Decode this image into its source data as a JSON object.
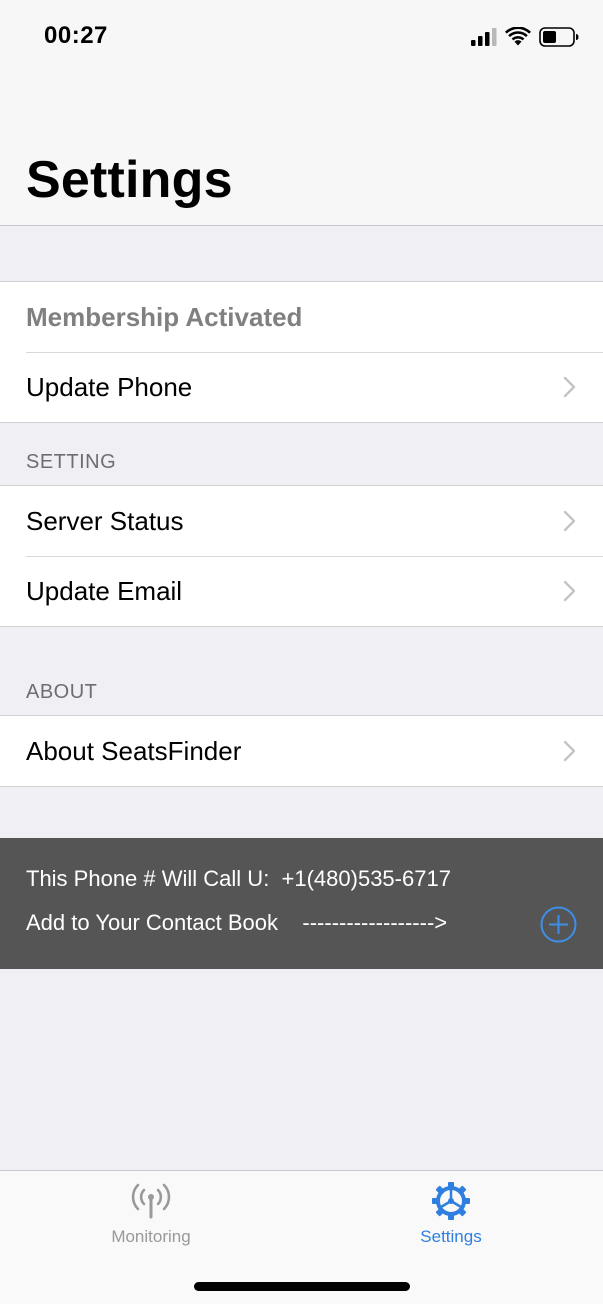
{
  "status_bar": {
    "time": "00:27",
    "icons": [
      "signal-icon",
      "wifi-icon",
      "battery-icon"
    ]
  },
  "header": {
    "title": "Settings"
  },
  "membership_group": {
    "items": [
      {
        "label": "Membership Activated",
        "has_chevron": false
      },
      {
        "label": "Update Phone",
        "has_chevron": true
      }
    ]
  },
  "setting_section": {
    "header": "SETTING",
    "items": [
      {
        "label": "Server Status",
        "has_chevron": true
      },
      {
        "label": "Update Email",
        "has_chevron": true
      }
    ]
  },
  "about_section": {
    "header": "ABOUT",
    "items": [
      {
        "label": "About SeatsFinder",
        "has_chevron": true
      }
    ]
  },
  "contact_banner": {
    "line1": "This Phone # Will Call U:  +1(480)535-6717",
    "line2": "Add to Your Contact Book    ------------------>",
    "button_icon": "plus-circle-icon"
  },
  "tab_bar": {
    "tabs": [
      {
        "label": "Monitoring",
        "icon": "antenna-icon",
        "active": false
      },
      {
        "label": "Settings",
        "icon": "gear-icon",
        "active": true
      }
    ]
  },
  "colors": {
    "accent": "#2f7fe0",
    "inactive_tab": "#999999",
    "banner_bg": "#555555",
    "group_bg": "#ffffff",
    "page_bg": "#efeff4"
  }
}
